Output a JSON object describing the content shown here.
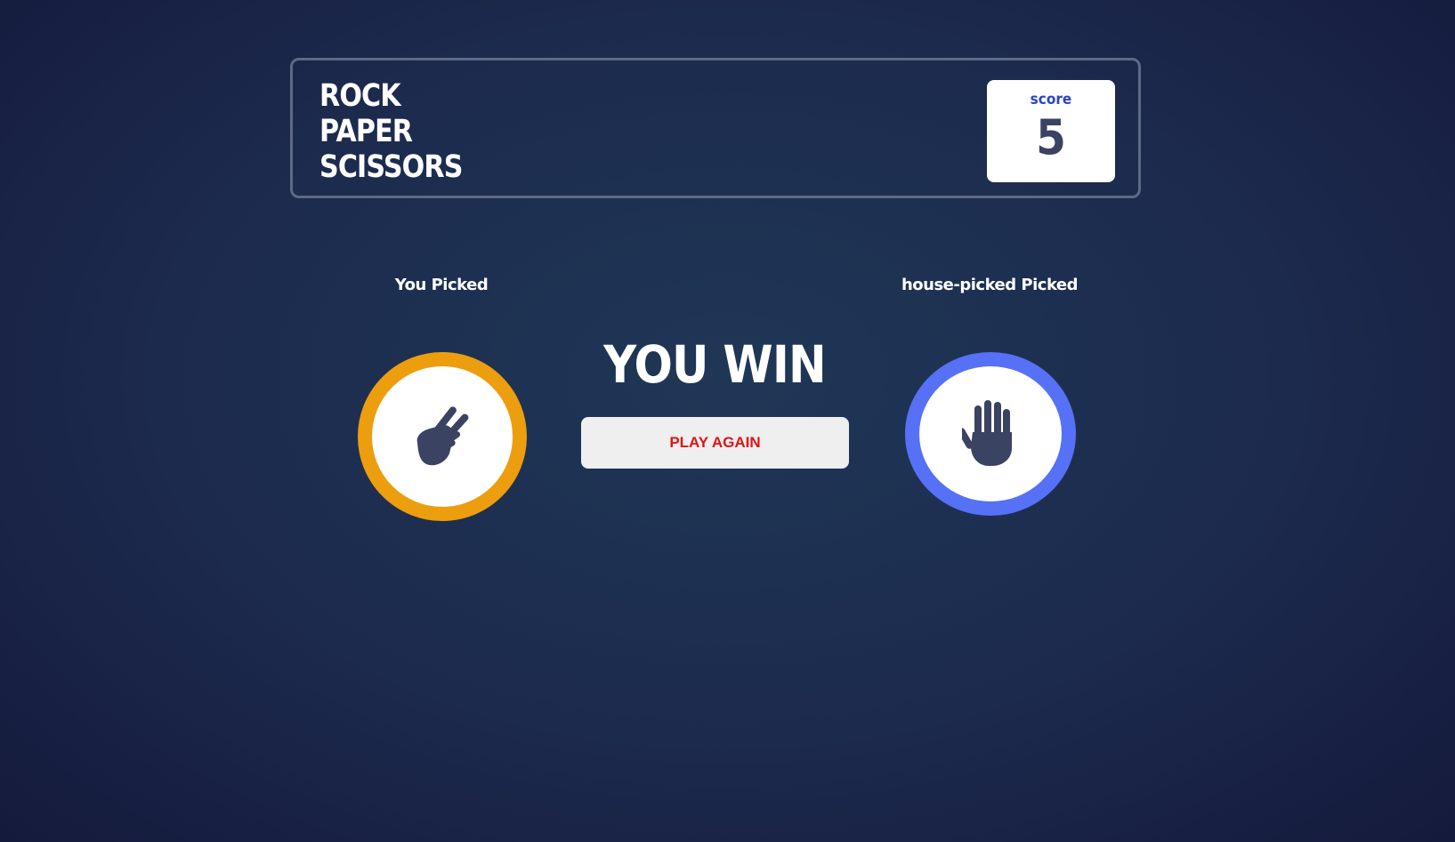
{
  "header": {
    "title_lines": [
      "ROCK",
      "PAPER",
      "SCISSORS"
    ],
    "score_label": "score",
    "score_value": "5"
  },
  "player": {
    "label": "You Picked",
    "choice": "scissors",
    "icon": "scissors-hand-icon",
    "ring_color": "#ec9e0e"
  },
  "house": {
    "label": "house-picked Picked",
    "choice": "paper",
    "icon": "paper-hand-icon",
    "ring_color": "#5671f5"
  },
  "result": {
    "text": "YOU WIN",
    "button_label": "PLAY AGAIN"
  },
  "colors": {
    "icon_fill": "#3b4363",
    "score_label": "#2a46c0",
    "button_text": "#e01414"
  }
}
